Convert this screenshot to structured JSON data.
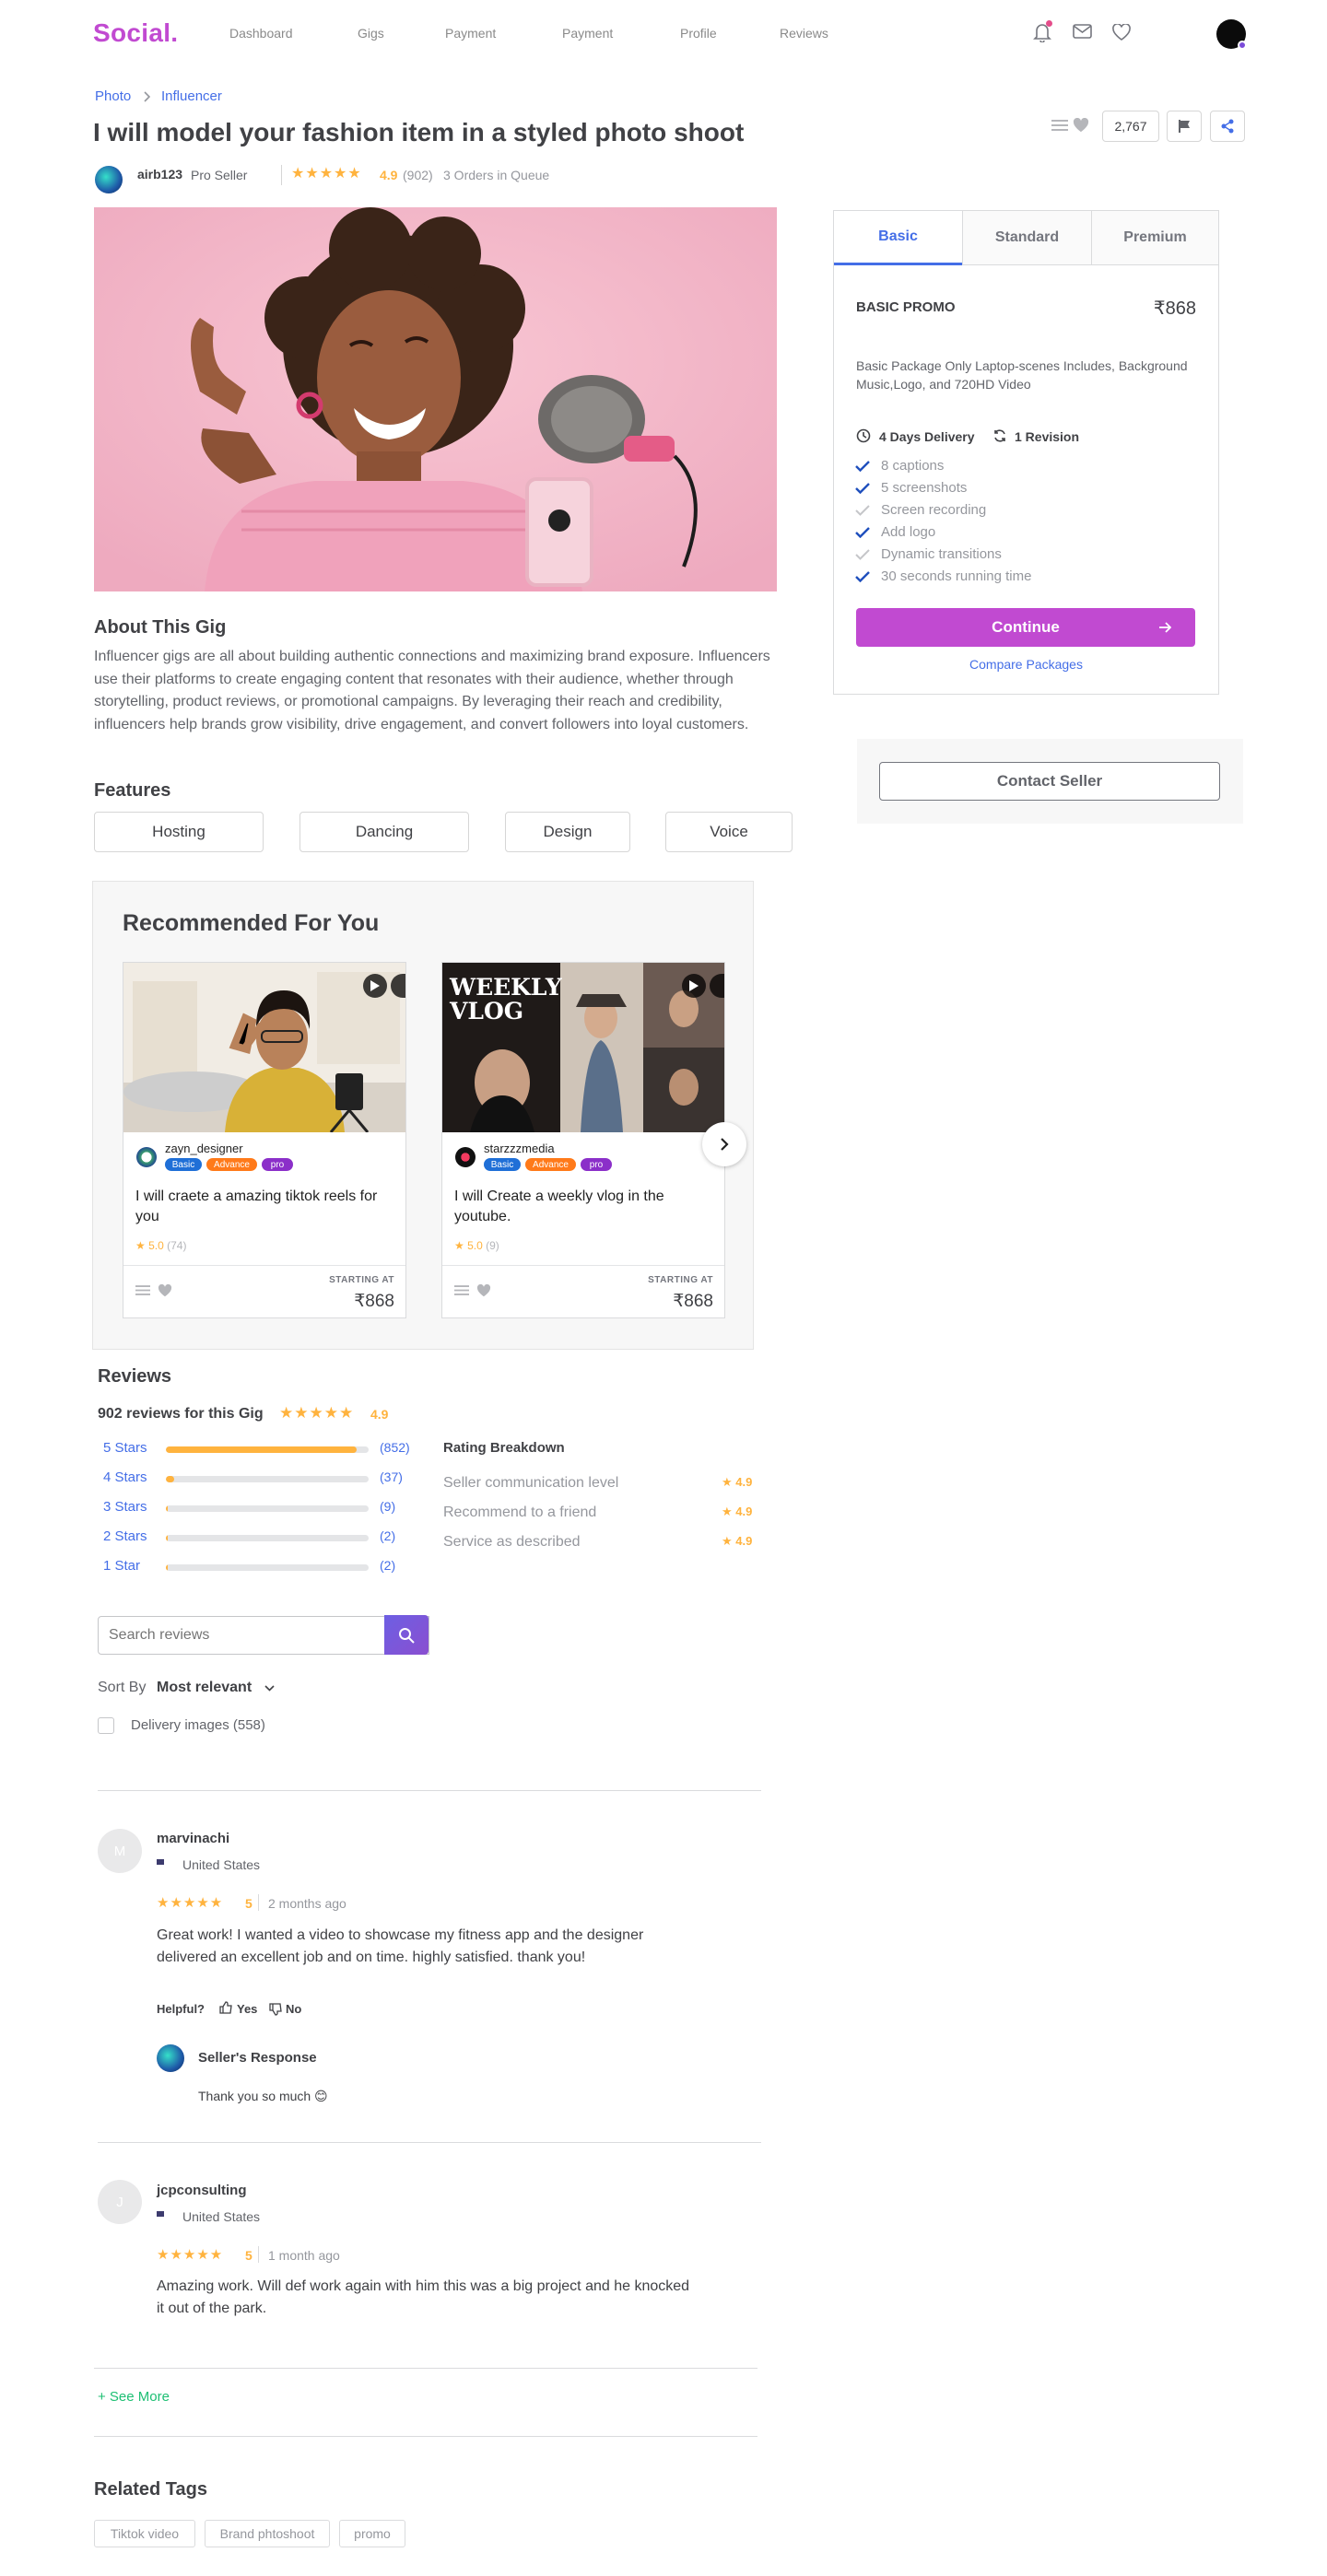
{
  "header": {
    "logo": "Social.",
    "nav": [
      "Dashboard",
      "Gigs",
      "Payment",
      "Payment",
      "Profile",
      "Reviews"
    ]
  },
  "breadcrumb": [
    "Photo",
    "Influencer"
  ],
  "gig": {
    "title": "I will model your fashion item in a styled photo shoot",
    "likes_count": "2,767",
    "seller": {
      "name": "airb123",
      "level": "Pro  Seller"
    },
    "rating": "4.9",
    "rating_count": "(902)",
    "queue": "3 Orders in Queue"
  },
  "about": {
    "heading": "About This Gig",
    "text": "Influencer gigs are all about building authentic connections and maximizing brand exposure. Influencers use their platforms to create engaging content that resonates with their audience, whether through storytelling, product reviews, or promotional campaigns. By leveraging their reach and credibility, influencers help brands grow visibility, drive engagement, and convert followers into loyal customers."
  },
  "features": {
    "heading": "Features",
    "items": [
      "Hosting",
      "Dancing",
      "Design",
      "Voice"
    ]
  },
  "recommended": {
    "heading": "Recommended For You",
    "cards": [
      {
        "user": "zayn_designer",
        "badges": [
          "Basic",
          "Advance",
          "pro"
        ],
        "title": "I will craete a amazing tiktok reels for you",
        "rating": "5.0",
        "count": "(74)",
        "starting_label": "STARTING AT",
        "price": "₹868"
      },
      {
        "user": "starzzzmedia",
        "badges": [
          "Basic",
          "Advance",
          "pro"
        ],
        "title": "I will Create a weekly vlog in the youtube.",
        "rating": "5.0",
        "count": "(9)",
        "starting_label": "STARTING AT",
        "price": "₹868",
        "thumb_text": "WEEKLY VLOG"
      }
    ]
  },
  "reviews": {
    "heading": "Reviews",
    "summary": "902 reviews for this Gig",
    "rating": "4.9",
    "bars": [
      {
        "label": "5 Stars",
        "count": "(852)",
        "fraction": 0.94
      },
      {
        "label": "4 Stars",
        "count": "(37)",
        "fraction": 0.04
      },
      {
        "label": "3 Stars",
        "count": "(9)",
        "fraction": 0.01
      },
      {
        "label": "2 Stars",
        "count": "(2)",
        "fraction": 0.002
      },
      {
        "label": "1 Star",
        "count": "(2)",
        "fraction": 0.002
      }
    ],
    "breakdown_heading": "Rating Breakdown",
    "breakdown": [
      {
        "label": "Seller communication level",
        "value": "4.9"
      },
      {
        "label": "Recommend to a friend",
        "value": "4.9"
      },
      {
        "label": "Service as described",
        "value": "4.9"
      }
    ],
    "search_placeholder": "Search reviews",
    "sort_label": "Sort By",
    "sort_value": "Most relevant",
    "filter_label": "Delivery images (558)",
    "items": [
      {
        "initial": "M",
        "name": "marvinachi",
        "country": "United States",
        "rating": "5",
        "time": "2 months ago",
        "text": "Great work! I wanted a video to showcase my fitness app and the designer delivered an excellent job and on time. highly satisfied. thank you!",
        "helpful": "Helpful?",
        "yes": "Yes",
        "no": "No",
        "response_title": "Seller's Response",
        "response_text": "Thank you so much 😊"
      },
      {
        "initial": "J",
        "name": "jcpconsulting",
        "country": "United States",
        "rating": "5",
        "time": "1 month ago",
        "text": "Amazing work. Will def work again with him this was a big project and he knocked it out of the park."
      }
    ],
    "see_more": "+ See More"
  },
  "related_tags": {
    "heading": "Related Tags",
    "items": [
      "Tiktok video",
      "Brand phtoshoot",
      "promo"
    ]
  },
  "package": {
    "tabs": [
      "Basic",
      "Standard",
      "Premium"
    ],
    "name": "BASIC PROMO",
    "price": "₹868",
    "description": "Basic Package Only Laptop-scenes Includes, Background Music,Logo, and 720HD Video",
    "delivery": "4 Days Delivery",
    "revisions": "1 Revision",
    "features": [
      {
        "label": "8 captions",
        "included": true
      },
      {
        "label": "5 screenshots",
        "included": true
      },
      {
        "label": "Screen recording",
        "included": false
      },
      {
        "label": "Add logo",
        "included": true
      },
      {
        "label": "Dynamic transitions",
        "included": false
      },
      {
        "label": "30 seconds running time",
        "included": true
      }
    ],
    "continue_label": "Continue",
    "compare_label": "Compare Packages",
    "contact_label": "Contact Seller"
  },
  "colors": {
    "brand": "#c14ad1",
    "link": "#446ee7",
    "star": "#ffb33e",
    "green": "#1dbf73"
  }
}
